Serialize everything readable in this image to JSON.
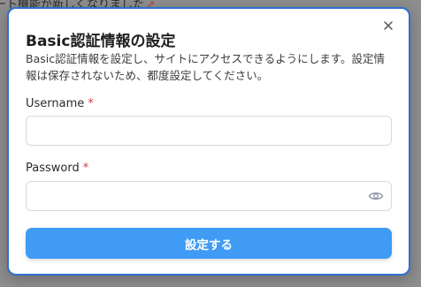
{
  "background": {
    "top_text": "ート機能が新しくなりました",
    "top_icon": "rocket-icon"
  },
  "modal": {
    "title": "Basic認証情報の設定",
    "description": "Basic認証情報を設定し、サイトにアクセスできるようにします。設定情報は保存されないため、都度設定してください。",
    "close_icon": "close-icon",
    "fields": {
      "username": {
        "label": "Username",
        "required_mark": "*",
        "value": ""
      },
      "password": {
        "label": "Password",
        "required_mark": "*",
        "value": "",
        "toggle_icon": "eye-icon"
      }
    },
    "submit_label": "設定する"
  },
  "colors": {
    "accent": "#3f9bf3",
    "modal_border": "#2f6fd1",
    "required": "#d9363e",
    "backdrop": "#8e8e8e"
  }
}
